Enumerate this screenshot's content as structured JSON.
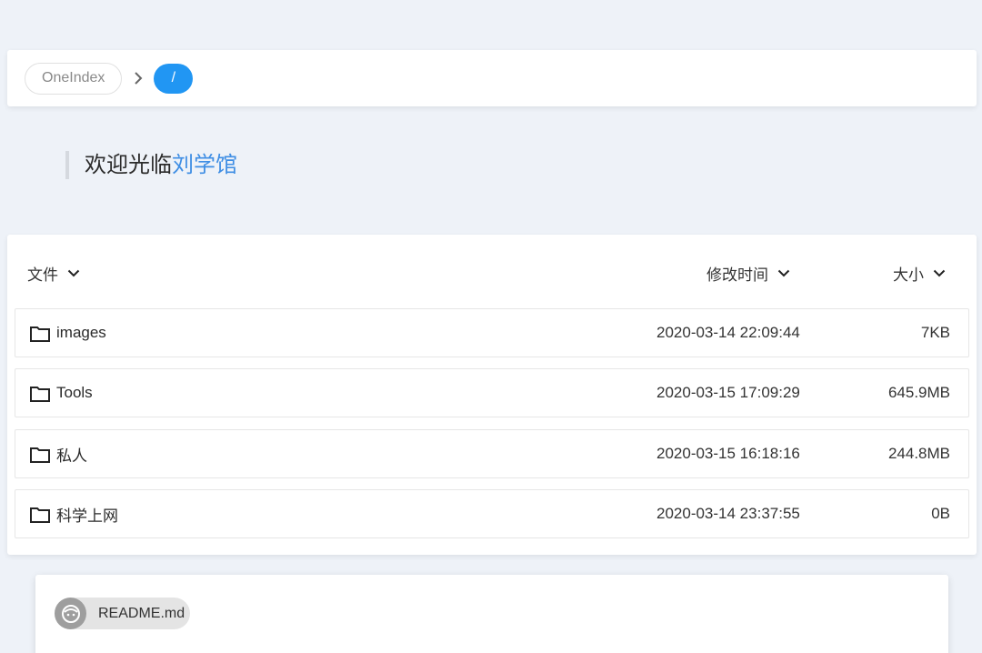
{
  "breadcrumb": {
    "home_label": "OneIndex",
    "current_label": "/"
  },
  "welcome": {
    "prefix": "欢迎光临",
    "highlight": "刘学馆"
  },
  "list": {
    "headers": {
      "file": "文件",
      "modified": "修改时间",
      "size": "大小"
    },
    "rows": [
      {
        "name": "images",
        "modified": "2020-03-14 22:09:44",
        "size": "7KB",
        "icon": "folder-icon"
      },
      {
        "name": "Tools",
        "modified": "2020-03-15 17:09:29",
        "size": "645.9MB",
        "icon": "folder-icon"
      },
      {
        "name": "私人",
        "modified": "2020-03-15 16:18:16",
        "size": "244.8MB",
        "icon": "folder-icon"
      },
      {
        "name": "科学上网",
        "modified": "2020-03-14 23:37:55",
        "size": "0B",
        "icon": "folder-icon"
      }
    ]
  },
  "readme": {
    "label": "README.md",
    "icon": "face-icon"
  },
  "colors": {
    "accent": "#2196f3",
    "highlight": "#3f8ee4",
    "background": "#eef2f8"
  }
}
